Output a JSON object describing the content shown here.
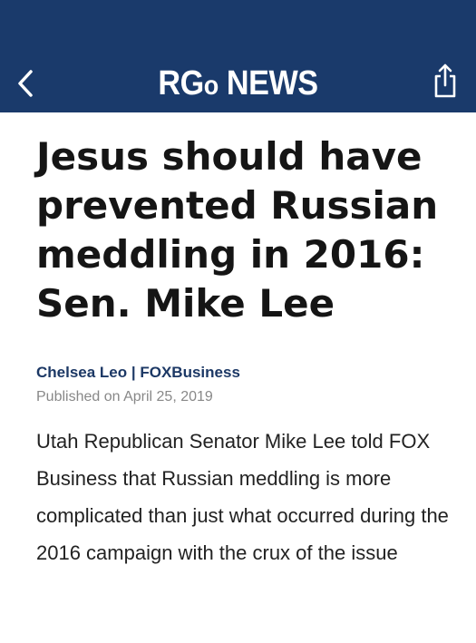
{
  "header": {
    "brand_part1": "RG",
    "brand_part2": "o",
    "brand_part3": " NEWS",
    "background_color": "#1a3a6b",
    "back_icon": "chevron-left-icon",
    "share_icon": "share-icon"
  },
  "article": {
    "headline": "Jesus should have prevented Russian meddling in 2016: Sen. Mike Lee",
    "author": "Chelsea Leo",
    "source": "FOXBusiness",
    "byline_separator": " | ",
    "published": "Published on April 25, 2019",
    "body": "Utah Republican Senator Mike Lee told FOX Business that Russian meddling is more complicated than just what occurred during the 2016 campaign with the crux of the issue"
  }
}
